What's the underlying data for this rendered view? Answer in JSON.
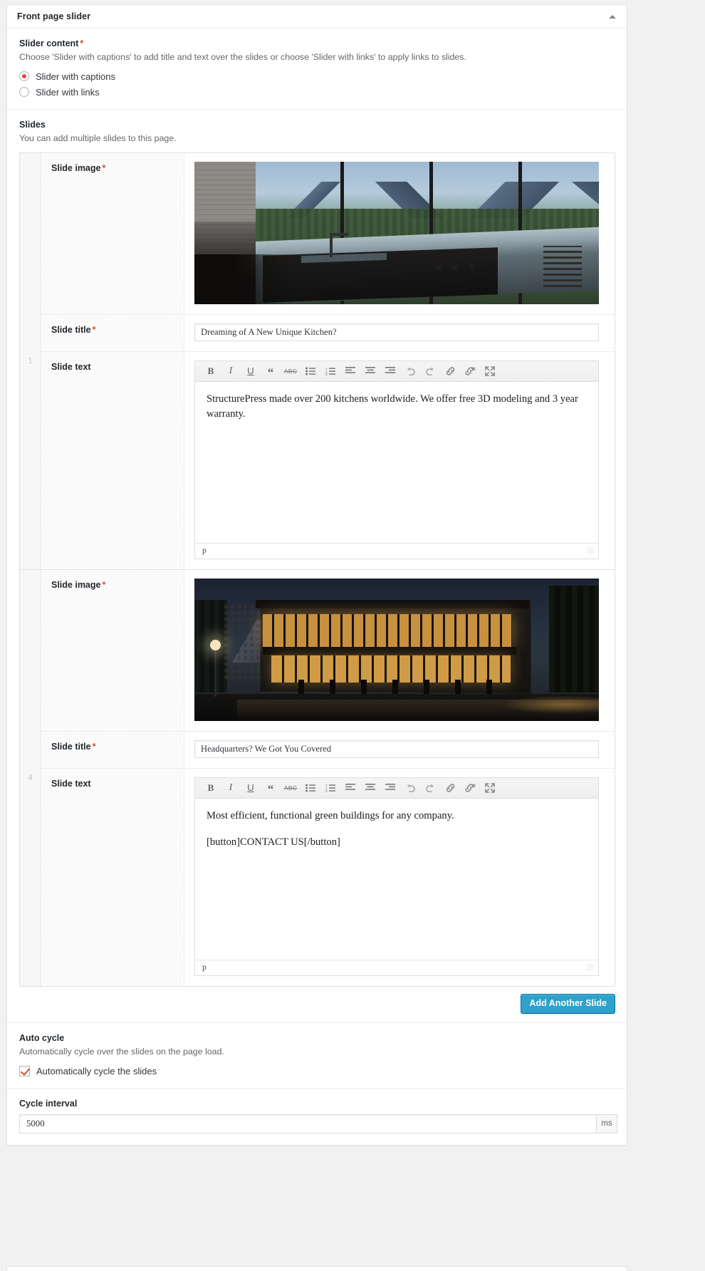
{
  "metabox": {
    "title": "Front page slider",
    "toggle_icon": "caret-up-icon"
  },
  "slider_content": {
    "label": "Slider content",
    "required_mark": "*",
    "description": "Choose 'Slider with captions' to add title and text over the slides or choose 'Slider with links' to apply links to slides.",
    "options": [
      {
        "label": "Slider with captions",
        "checked": true
      },
      {
        "label": "Slider with links",
        "checked": false
      }
    ]
  },
  "slides_section": {
    "label": "Slides",
    "description": "You can add multiple slides to this page.",
    "add_button_label": "Add Another Slide",
    "field_labels": {
      "image": "Slide image",
      "title": "Slide title",
      "text": "Slide text"
    },
    "required_mark": "*",
    "editor_toolbar": [
      "bold-icon",
      "italic-icon",
      "underline-icon",
      "blockquote-icon",
      "strikethrough-icon",
      "bulleted-list-icon",
      "numbered-list-icon",
      "align-left-icon",
      "align-center-icon",
      "align-right-icon",
      "undo-icon",
      "redo-icon",
      "link-icon",
      "unlink-icon",
      "fullscreen-icon"
    ],
    "editor_status_path": "p",
    "items": [
      {
        "order": "1",
        "image_alt": "modern kitchen with mountain view",
        "title_value": "Dreaming of A New Unique Kitchen?",
        "text_paragraphs": [
          "StructurePress made over 200 kitchens worldwide. We offer free 3D modeling and 3 year warranty."
        ]
      },
      {
        "order": "4",
        "image_alt": "illuminated modern office building at night",
        "title_value": "Headquarters? We Got You Covered",
        "text_paragraphs": [
          "Most efficient, functional green buildings for any company.",
          "[button]CONTACT US[/button]"
        ]
      }
    ]
  },
  "auto_cycle": {
    "label": "Auto cycle",
    "description": "Automatically cycle over the slides on the page load.",
    "checkbox_label": "Automatically cycle the slides",
    "checked": true
  },
  "cycle_interval": {
    "label": "Cycle interval",
    "value": "5000",
    "unit": "ms"
  },
  "colors": {
    "accent_blue": "#2ea2cc",
    "required_red": "#d54e21",
    "radio_red": "#e14d43",
    "heading": "#23282d",
    "muted": "#666666"
  }
}
